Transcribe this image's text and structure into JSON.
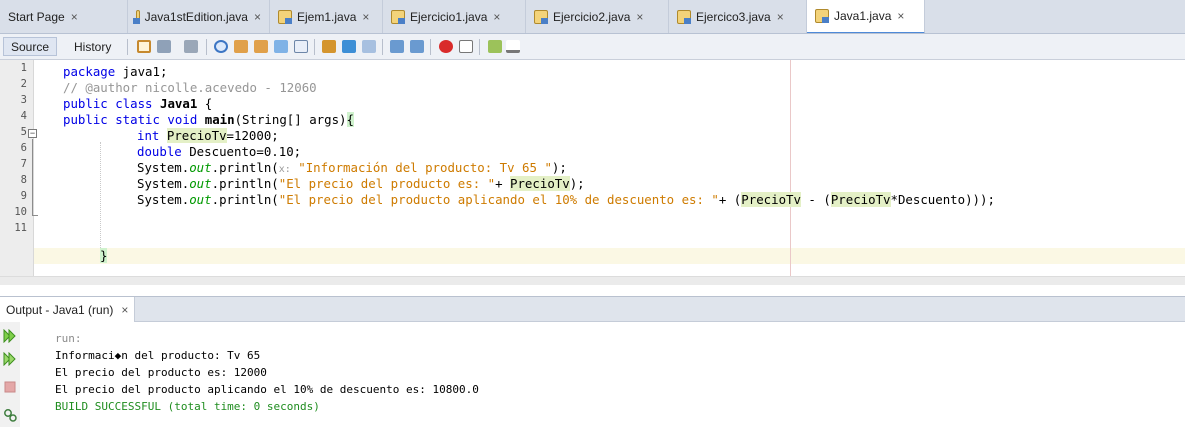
{
  "tabs": [
    {
      "label": "Start Page",
      "icon": "none",
      "active": false
    },
    {
      "label": "Java1stEdition.java",
      "icon": "java-file-icon",
      "active": false
    },
    {
      "label": "Ejem1.java",
      "icon": "java-file-icon",
      "active": false
    },
    {
      "label": "Ejercicio1.java",
      "icon": "java-file-icon",
      "active": false
    },
    {
      "label": "Ejercicio2.java",
      "icon": "java-file-icon",
      "active": false
    },
    {
      "label": "Ejercico3.java",
      "icon": "java-file-icon",
      "active": false
    },
    {
      "label": "Java1.java",
      "icon": "java-file-icon",
      "active": true
    }
  ],
  "close_glyph": "×",
  "toolbar": {
    "source_label": "Source",
    "history_label": "History"
  },
  "editor": {
    "line_numbers": [
      "1",
      "2",
      "3",
      "4",
      "5",
      "6",
      "7",
      "8",
      "9",
      "10",
      "11"
    ],
    "code": {
      "l1_kw": "package",
      "l1_rest": " java1;",
      "l2_comment": "// @author nicolle.acevedo - 12060",
      "l3_kw": "public class",
      "l3_cls": "Java1",
      "l3_rest": " {",
      "l4_kw": "public static void",
      "l4_meth": "main",
      "l4_rest": "(String[] args)",
      "l4_brace": "{",
      "l5_kw": "int",
      "l5_var": "PrecioTv",
      "l5_rest": "=12000;",
      "l6_kw": "double",
      "l6_rest": " Descuento=0.10;",
      "sys": "System.",
      "out": "out",
      "println": ".println(",
      "l7_hint": "x:",
      "l7_str": "\"Información del producto: Tv 65 \"",
      "l7_end": ");",
      "l8_str": "\"El precio del producto es: \"",
      "l8_plus": "+ ",
      "l8_var": "PrecioTv",
      "l8_end": ");",
      "l9_str": "\"El precio del producto aplicando el 10% de descuento es: \"",
      "l9_plus": "+ (",
      "l9_var1": "PrecioTv",
      "l9_minus": " - (",
      "l9_var2": "PrecioTv",
      "l9_end": "*Descuento)));",
      "l10_brace": "}"
    }
  },
  "output": {
    "tab_label": "Output - Java1 (run)",
    "lines": [
      "run:",
      "Informaci◆n del producto: Tv 65",
      "El precio del producto es: 12000",
      "El precio del producto aplicando el 10% de descuento es: 10800.0",
      "BUILD SUCCESSFUL (total time: 0 seconds)"
    ]
  },
  "colors": {
    "keyword": "#0000e6",
    "comment": "#969696",
    "string": "#ce7b00",
    "field": "#009900",
    "build_success": "#1f8d1f"
  }
}
